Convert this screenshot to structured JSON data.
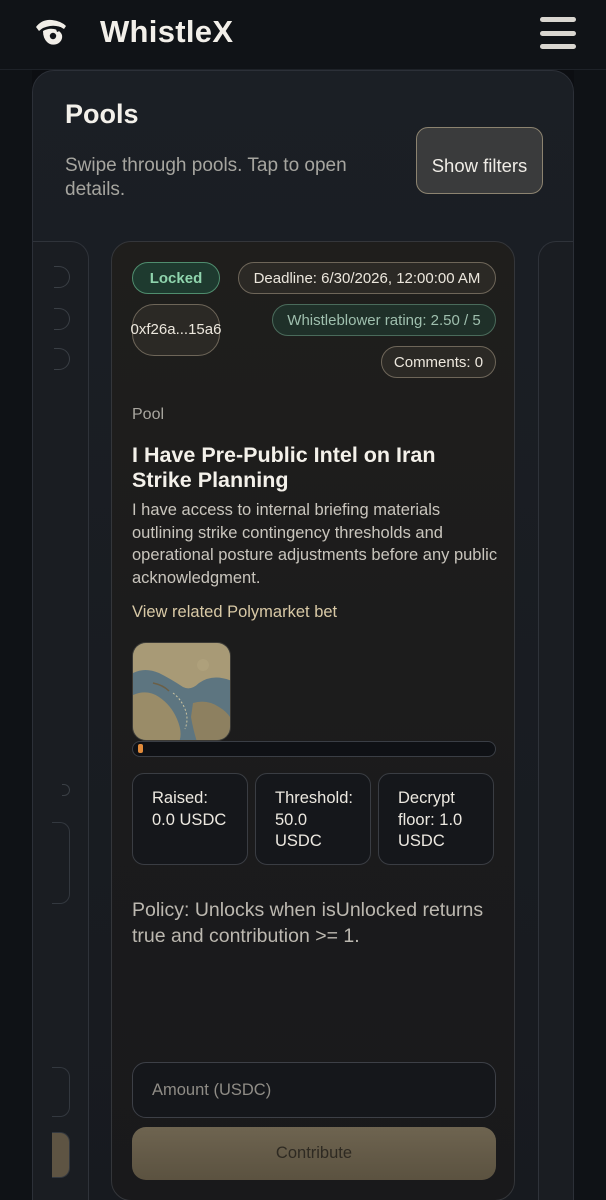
{
  "header": {
    "brand": "WhistleX",
    "logo_icon": "whistle-hand-icon",
    "menu_icon": "hamburger-menu-icon"
  },
  "pools": {
    "title": "Pools",
    "subtitle": "Swipe through pools. Tap to open details.",
    "filters_button": "Show filters"
  },
  "card": {
    "status": "Locked",
    "deadline": "Deadline: 6/30/2026, 12:00:00 AM",
    "address": "0xf26a...15a6",
    "rating": "Whistleblower rating: 2.50 / 5",
    "comments": "Comments: 0",
    "type_label": "Pool",
    "title": "I Have Pre-Public Intel on Iran Strike Planning",
    "description": "I have access to internal briefing materials outlining strike contingency thresholds and operational posture adjustments before any public acknowledgment.",
    "related_link": "View related Polymarket bet",
    "image_icon": "map-thumbnail",
    "progress_fraction": 0.02,
    "stats": {
      "raised": "Raised: 0.0 USDC",
      "threshold": "Threshold: 50.0 USDC",
      "decrypt_floor": "Decrypt floor: 1.0 USDC"
    },
    "policy": "Policy: Unlocks when isUnlocked returns true and contribution >= 1.",
    "amount_placeholder": "Amount (USDC)",
    "contribute_button": "Contribute"
  },
  "colors": {
    "locked_green": "#8fd4ad",
    "accent_gold": "#d8c9a6",
    "progress_orange": "#e08a3a"
  }
}
